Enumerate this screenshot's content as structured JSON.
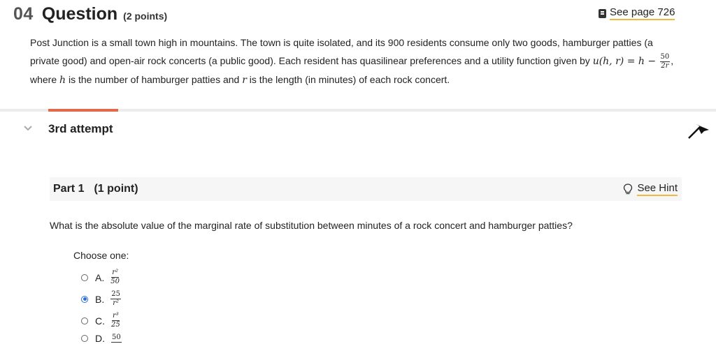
{
  "question": {
    "number": "04",
    "word": "Question",
    "points": "(2 points)",
    "see_page": "See page 726",
    "prompt_1": "Post Junction is a small town high in mountains. The town is quite isolated, and its 900 residents consume only two goods, hamburger patties (a private good) and open-air rock concerts (a public good). Each resident has quasilinear preferences and a utility function given by ",
    "utility_lhs": "u(h, r) = h − ",
    "utility_num": "50",
    "utility_den": "2r",
    "prompt_comma": ",",
    "prompt_2a": "where ",
    "var_h": "h",
    "prompt_2b": " is the number of hamburger patties and ",
    "var_r": "r",
    "prompt_2c": " is the length (in minutes) of each rock concert."
  },
  "attempt": {
    "title": "3rd attempt"
  },
  "part": {
    "label": "Part 1",
    "points": "(1 point)",
    "hint": "See Hint",
    "question": "What is the absolute value of the marginal rate of substitution between minutes of a rock concert and hamburger patties?",
    "choose_label": "Choose one:",
    "options": [
      {
        "letter": "A.",
        "num": "r²",
        "den": "50",
        "selected": false
      },
      {
        "letter": "B.",
        "num": "25",
        "den": "r²",
        "selected": true
      },
      {
        "letter": "C.",
        "num": "r³",
        "den": "25",
        "selected": false
      },
      {
        "letter": "D.",
        "num": "50",
        "den": "",
        "selected": false
      }
    ]
  },
  "colors": {
    "accent": "#e2694a",
    "link_underline": "#f0b840",
    "radio_selected": "#2b6fd6"
  }
}
